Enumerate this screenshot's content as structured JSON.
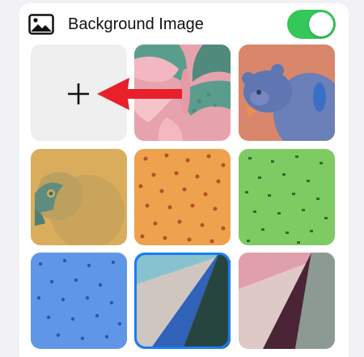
{
  "header": {
    "icon": "photo-icon",
    "title": "Background Image",
    "toggle_on": true
  },
  "colors": {
    "toggle_on": "#34c759",
    "selection_ring": "#1a7cf3",
    "annotation_arrow": "#e8202a"
  },
  "grid": {
    "add_tile": {
      "label": "+",
      "icon": "plus-icon"
    },
    "wallpapers": [
      {
        "name": "butterfly",
        "selected": false
      },
      {
        "name": "bear",
        "selected": false
      },
      {
        "name": "parrot",
        "selected": false
      },
      {
        "name": "orange-pattern",
        "selected": false
      },
      {
        "name": "green-pattern",
        "selected": false
      },
      {
        "name": "blue-pattern",
        "selected": false
      },
      {
        "name": "blue-folds",
        "selected": true
      },
      {
        "name": "pink-folds",
        "selected": false
      }
    ]
  },
  "annotation": {
    "icon": "red-arrow-icon"
  }
}
